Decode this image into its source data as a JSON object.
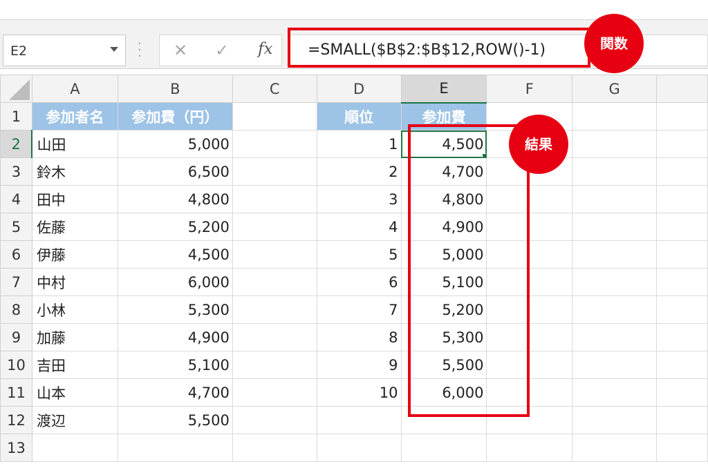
{
  "formula_bar": {
    "name_box": "E2",
    "formula": "=SMALL($B$2:$B$12,ROW()-1)",
    "cancel_glyph": "✕",
    "enter_glyph": "✓",
    "fx_glyph": "fx"
  },
  "columns": [
    "A",
    "B",
    "C",
    "D",
    "E",
    "F",
    "G"
  ],
  "rows": [
    "1",
    "2",
    "3",
    "4",
    "5",
    "6",
    "7",
    "8",
    "9",
    "10",
    "11",
    "12",
    "13"
  ],
  "headers": {
    "a": "参加者名",
    "b": "参加費（円）",
    "d": "順位",
    "e": "参加費"
  },
  "participants": [
    {
      "name": "山田",
      "fee": "5,000"
    },
    {
      "name": "鈴木",
      "fee": "6,500"
    },
    {
      "name": "田中",
      "fee": "4,800"
    },
    {
      "name": "佐藤",
      "fee": "5,200"
    },
    {
      "name": "伊藤",
      "fee": "4,500"
    },
    {
      "name": "中村",
      "fee": "6,000"
    },
    {
      "name": "小林",
      "fee": "5,300"
    },
    {
      "name": "加藤",
      "fee": "4,900"
    },
    {
      "name": "吉田",
      "fee": "5,100"
    },
    {
      "name": "山本",
      "fee": "4,700"
    },
    {
      "name": "渡辺",
      "fee": "5,500"
    }
  ],
  "results": [
    {
      "rank": "1",
      "fee": "4,500"
    },
    {
      "rank": "2",
      "fee": "4,700"
    },
    {
      "rank": "3",
      "fee": "4,800"
    },
    {
      "rank": "4",
      "fee": "4,900"
    },
    {
      "rank": "5",
      "fee": "5,000"
    },
    {
      "rank": "6",
      "fee": "5,100"
    },
    {
      "rank": "7",
      "fee": "5,200"
    },
    {
      "rank": "8",
      "fee": "5,300"
    },
    {
      "rank": "9",
      "fee": "5,500"
    },
    {
      "rank": "10",
      "fee": "6,000"
    }
  ],
  "annotations": {
    "function_label": "関数",
    "result_label": "結果",
    "highlight_color": "#e60012",
    "header_fill": "#9dc3e6",
    "selection_color": "#217346"
  }
}
